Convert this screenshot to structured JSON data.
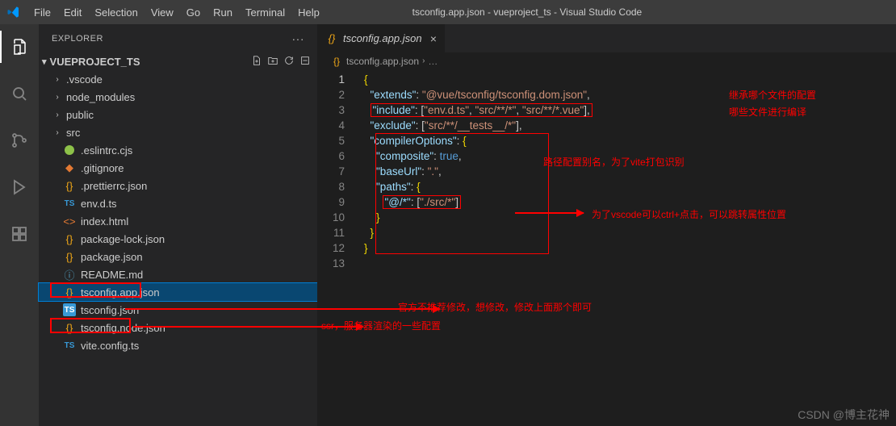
{
  "window": {
    "title": "tsconfig.app.json - vueproject_ts - Visual Studio Code"
  },
  "menu": {
    "items": [
      "File",
      "Edit",
      "Selection",
      "View",
      "Go",
      "Run",
      "Terminal",
      "Help"
    ]
  },
  "sidebar": {
    "header": "EXPLORER",
    "project": "VUEPROJECT_TS",
    "folders": [
      ".vscode",
      "node_modules",
      "public",
      "src"
    ],
    "files": [
      {
        "name": ".eslintrc.cjs",
        "icon": "cjs"
      },
      {
        "name": ".gitignore",
        "icon": "git"
      },
      {
        "name": ".prettierrc.json",
        "icon": "json"
      },
      {
        "name": "env.d.ts",
        "icon": "ts"
      },
      {
        "name": "index.html",
        "icon": "html"
      },
      {
        "name": "package-lock.json",
        "icon": "json"
      },
      {
        "name": "package.json",
        "icon": "json"
      },
      {
        "name": "README.md",
        "icon": "info"
      },
      {
        "name": "tsconfig.app.json",
        "icon": "json",
        "selected": true
      },
      {
        "name": "tsconfig.json",
        "icon": "ts"
      },
      {
        "name": "tsconfig.node.json",
        "icon": "json"
      },
      {
        "name": "vite.config.ts",
        "icon": "ts"
      }
    ]
  },
  "tab": {
    "label": "tsconfig.app.json"
  },
  "breadcrumb": {
    "item": "tsconfig.app.json"
  },
  "code": {
    "lines": 13,
    "l1_brace": "{",
    "l2_key": "\"extends\"",
    "l2_val": "\"@vue/tsconfig/tsconfig.dom.json\"",
    "l3_key": "\"include\"",
    "l3_v1": "\"env.d.ts\"",
    "l3_v2": "\"src/**/*\"",
    "l3_v3": "\"src/**/*.vue\"",
    "l4_key": "\"exclude\"",
    "l4_v1": "\"src/**/__tests__/*\"",
    "l5_key": "\"compilerOptions\"",
    "l6_key": "\"composite\"",
    "l7_key": "\"baseUrl\"",
    "l7_val": "\".\"",
    "l8_key": "\"paths\"",
    "l9_key": "\"@/*\"",
    "l9_val": "\"./src/*\"",
    "l10": "    }",
    "l11": "  }",
    "l12": "}",
    "colon": ": ",
    "comma": ",",
    "open_a": "[",
    "close_a": "]",
    "open_b": "{",
    "close_b": "}",
    "true": "true"
  },
  "annotations": {
    "a1": "继承哪个文件的配置",
    "a2": "哪些文件进行编译",
    "a3": "路径配置别名，为了vite打包识别",
    "a4": "为了vscode可以ctrl+点击，可以跳转属性位置",
    "a5": "官方不推荐修改，想修改，修改上面那个即可",
    "a6": "ssr，服务器渲染的一些配置"
  },
  "watermark": "CSDN @博主花神"
}
